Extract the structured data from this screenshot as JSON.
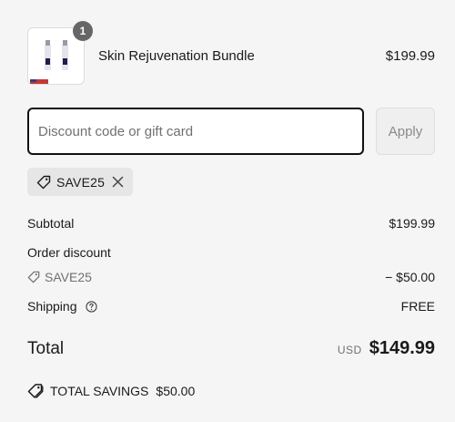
{
  "product": {
    "name": "Skin Rejuvenation Bundle",
    "price": "$199.99",
    "quantity": "1",
    "image_icon": "product-bottles-image"
  },
  "discount": {
    "placeholder": "Discount code or gift card",
    "value": "",
    "apply_label": "Apply",
    "applied_code": "SAVE25"
  },
  "summary": {
    "subtotal_label": "Subtotal",
    "subtotal_value": "$199.99",
    "order_discount_label": "Order discount",
    "discount_code": "SAVE25",
    "discount_value": "− $50.00",
    "shipping_label": "Shipping",
    "shipping_value": "FREE",
    "total_label": "Total",
    "currency": "USD",
    "total_value": "$149.99",
    "savings_label": "TOTAL SAVINGS",
    "savings_value": "$50.00"
  },
  "colors": {
    "background": "#f5f5f5",
    "badge": "#666666",
    "input_border": "#111111",
    "muted_text": "#707070"
  }
}
